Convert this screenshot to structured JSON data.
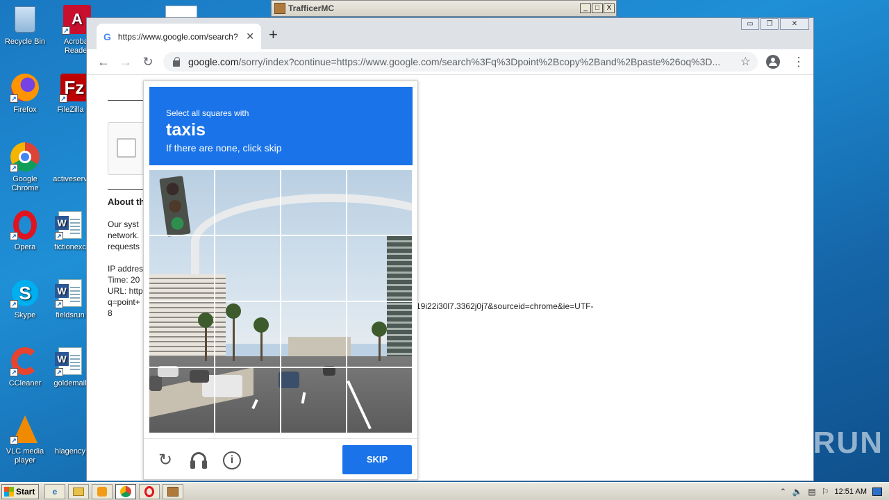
{
  "desktop": {
    "icons": [
      {
        "label": "Recycle Bin"
      },
      {
        "label": "Acrobat Reader"
      },
      {
        "label": "Firefox"
      },
      {
        "label": "FileZilla C"
      },
      {
        "label": "Google Chrome"
      },
      {
        "label": "activeserv"
      },
      {
        "label": "Opera"
      },
      {
        "label": "fictionexc"
      },
      {
        "label": "Skype"
      },
      {
        "label": "fieldsrun"
      },
      {
        "label": "CCleaner"
      },
      {
        "label": "goldemail"
      },
      {
        "label": "VLC media player"
      },
      {
        "label": "hiagency"
      }
    ]
  },
  "trafficer": {
    "title": "TrafficerMC",
    "min": "_",
    "max": "□",
    "close": "X"
  },
  "browser": {
    "tab_title": "https://www.google.com/search?q=",
    "tab_close": "✕",
    "new_tab": "+",
    "url_host": "google.com",
    "url_rest": "/sorry/index?continue=https://www.google.com/search%3Fq%3Dpoint%2Bcopy%2Band%2Bpaste%26oq%3D...",
    "back": "←",
    "forward": "→",
    "reload": "↻",
    "star": "☆",
    "menu": "⋮",
    "win_min": "▭",
    "win_restore": "❐",
    "win_close": "✕"
  },
  "page": {
    "about_heading": "About th",
    "system_text": [
      "Our syst",
      "network.",
      "requests"
    ],
    "ip_text": [
      "IP addres",
      "Time: 20",
      "URL: http",
      "q=point+",
      "8"
    ],
    "url_tail": "19i22i30l7.3362j0j7&sourceid=chrome&ie=UTF-"
  },
  "captcha": {
    "instruction_line1": "Select all squares with",
    "target": "taxis",
    "instruction_line3": "If there are none, click skip",
    "skip_label": "SKIP",
    "reload_icon": "↻",
    "info_icon": "i",
    "grid_size": 4
  },
  "watermark": "ANY▷RUN",
  "taskbar": {
    "start_label": "Start",
    "clock": "12:51 AM"
  },
  "colors": {
    "captcha_blue": "#1a73e8",
    "desktop_blue": "#1f8fd6"
  }
}
